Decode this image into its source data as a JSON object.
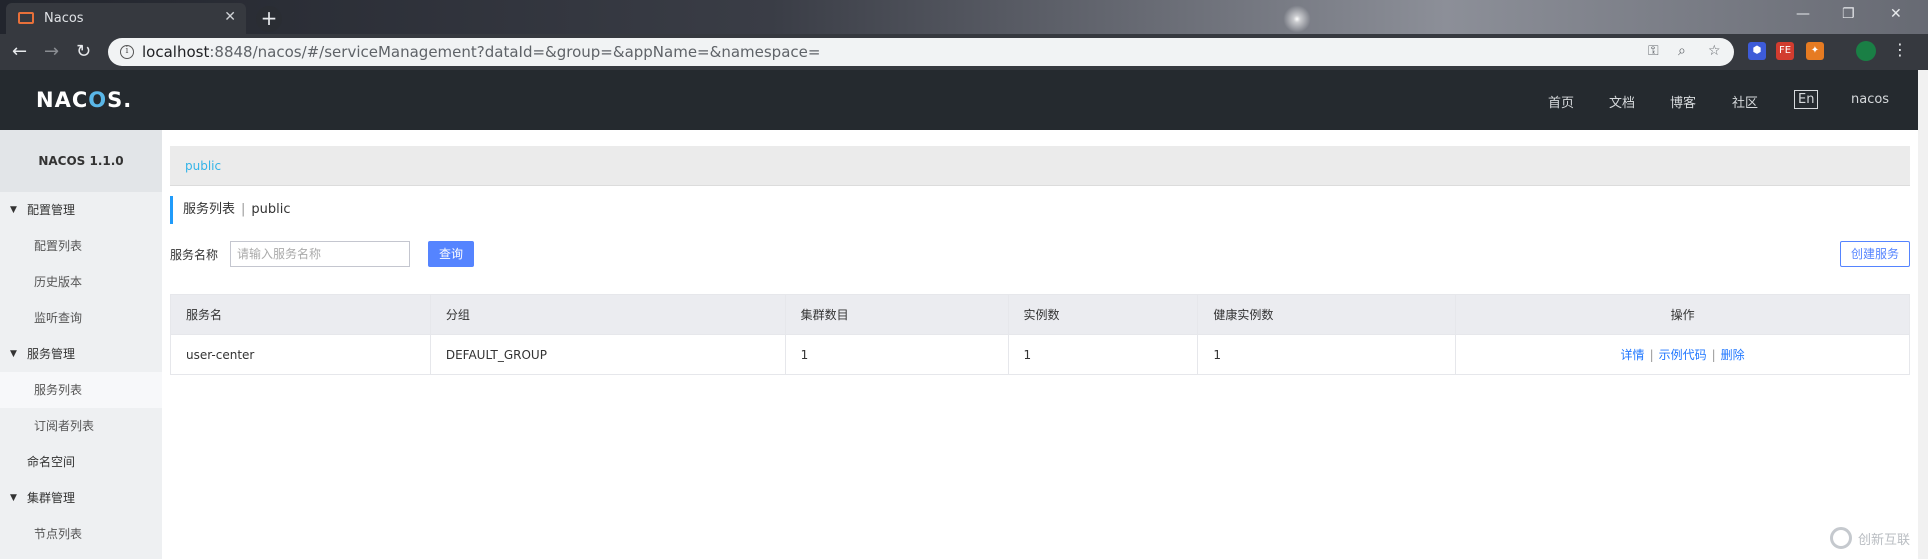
{
  "browser": {
    "tab_title": "Nacos",
    "tab_close": "✕",
    "new_tab": "+",
    "url_host": "localhost",
    "url_rest": ":8848/nacos/#/serviceManagement?dataId=&group=&appName=&namespace="
  },
  "header": {
    "logo_pre": "NAC",
    "logo_o": "O",
    "logo_post": "S.",
    "nav": [
      "首页",
      "文档",
      "博客",
      "社区"
    ],
    "lang": "En",
    "user": "nacos"
  },
  "sidebar": {
    "version": "NACOS 1.1.0",
    "groups": [
      {
        "label": "配置管理",
        "items": [
          "配置列表",
          "历史版本",
          "监听查询"
        ]
      },
      {
        "label": "服务管理",
        "items": [
          "服务列表",
          "订阅者列表"
        ]
      },
      {
        "label": "命名空间"
      },
      {
        "label": "集群管理",
        "items": [
          "节点列表"
        ]
      }
    ],
    "active_item": "服务列表"
  },
  "main": {
    "namespace": "public",
    "title": "服务列表",
    "title_sep": "|",
    "title_ns": "public",
    "filter_label": "服务名称",
    "filter_placeholder": "请输入服务名称",
    "query_button": "查询",
    "create_button": "创建服务",
    "table": {
      "headers": [
        "服务名",
        "分组",
        "集群数目",
        "实例数",
        "健康实例数",
        "操作"
      ],
      "rows": [
        {
          "name": "user-center",
          "group": "DEFAULT_GROUP",
          "clusters": "1",
          "instances": "1",
          "healthy": "1",
          "actions": [
            "详情",
            "示例代码",
            "删除"
          ]
        }
      ]
    }
  },
  "watermark": "创新互联"
}
